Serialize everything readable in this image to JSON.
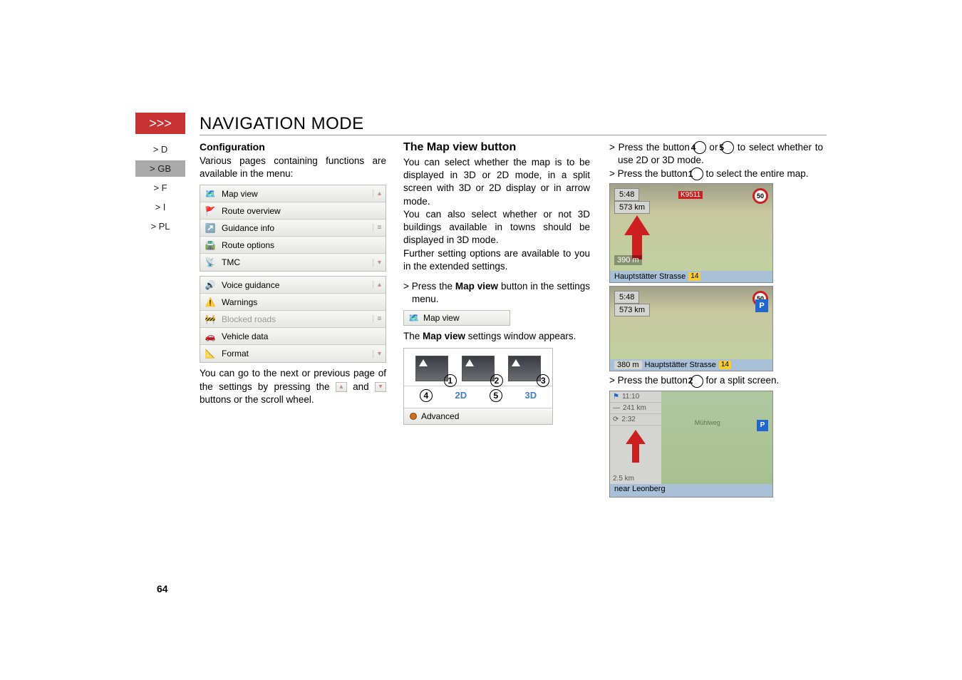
{
  "page_number": "64",
  "chevrons": ">>>",
  "title": "NAVIGATION MODE",
  "lang_nav": {
    "d": "> D",
    "gb": "> GB",
    "f": "> F",
    "i": "> I",
    "pl": "> PL"
  },
  "col1": {
    "heading": "Configuration",
    "intro": "Various pages containing functions are available in the menu:",
    "list1": [
      "Map view",
      "Route overview",
      "Guidance info",
      "Route options",
      "TMC"
    ],
    "list2": [
      "Voice guidance",
      "Warnings",
      "Blocked roads",
      "Vehicle data",
      "Format"
    ],
    "list2_grey_index": 2,
    "p1a": "You can go to the next or previous page of the settings by pressing the ",
    "p1b": " and ",
    "p1c": " buttons or the scroll wheel."
  },
  "col2": {
    "heading": "The Map view button",
    "p1": "You can select whether the map is to be displayed in 3D or 2D mode, in a split screen with 3D or 2D display or in arrow mode.",
    "p2": "You can also select whether or not 3D buildings available in towns should be displayed in 3D mode.",
    "p3": "Further setting options are available to you in the extended settings.",
    "bullet1a": "> Press the ",
    "bullet1_bold": "Map view",
    "bullet1b": " button in the settings menu.",
    "btn_label": "Map view",
    "sentence_a": "The ",
    "sentence_bold": "Map view",
    "sentence_b": " settings window appears.",
    "panel": {
      "n1": "1",
      "n2": "2",
      "n3": "3",
      "n4": "4",
      "n5": "5",
      "mid_2d": "2D",
      "mid_3d": "3D",
      "advanced": "Advanced"
    }
  },
  "col3": {
    "b1a": "> Press the button ",
    "b1n4": "4",
    "b1or": " or ",
    "b1n5": "5",
    "b1b": " to select whether to use 2D or 3D mode.",
    "b2a": "> Press the button ",
    "b2n1": "1",
    "b2b": " to select the entire map.",
    "map1": {
      "t1": "5:48",
      "t2": "573 km",
      "dist": "390 m",
      "street": "Hauptstätter Strasse",
      "marker": "14",
      "road": "K9511",
      "badge": "50"
    },
    "map2": {
      "t1": "5:48",
      "t2": "573 km",
      "dist": "380 m",
      "street": "Hauptstätter Strasse",
      "marker": "14",
      "badge": "50"
    },
    "b3a": "> Press the button ",
    "b3n2": "2",
    "b3b": " for a split screen.",
    "split": {
      "r1": "11:10",
      "r2": "241 km",
      "r3": "2:32",
      "dist": "2.5 km",
      "street": "near Leonberg",
      "motorway": "Mühlweg"
    }
  }
}
